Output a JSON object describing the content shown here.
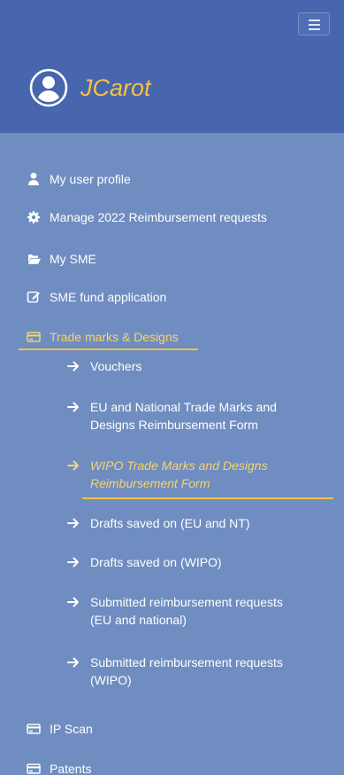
{
  "user": {
    "name": "JCarot"
  },
  "nav": {
    "profile": "My user profile",
    "manage": "Manage 2022 Reimbursement requests",
    "sme": "My SME",
    "fund": "SME fund application",
    "trademarks": "Trade marks & Designs",
    "ip_scan": "IP Scan",
    "patents": "Patents"
  },
  "submenu": [
    {
      "label": "Vouchers",
      "active": false
    },
    {
      "label": "EU and National Trade Marks and\nDesigns Reimbursement Form",
      "active": false
    },
    {
      "label": "WIPO Trade Marks and Designs\nReimbursement Form",
      "active": true
    },
    {
      "label": "Drafts saved on (EU and NT)",
      "active": false
    },
    {
      "label": "Drafts saved on (WIPO)",
      "active": false
    },
    {
      "label": "Submitted reimbursement requests\n(EU and national)",
      "active": false
    },
    {
      "label": "Submitted reimbursement requests\n(WIPO)",
      "active": false
    }
  ],
  "colors": {
    "header": "#4766ae",
    "body": "#6f8dc0",
    "accent": "#f2c246"
  },
  "icons": {
    "menu": "hamburger-icon",
    "avatar": "user-avatar-icon",
    "profile": "user-icon",
    "manage": "gear-icon",
    "sme": "folder-open-icon",
    "fund": "edit-icon",
    "trademarks": "credit-card-icon",
    "submenu": "arrow-right-icon"
  }
}
